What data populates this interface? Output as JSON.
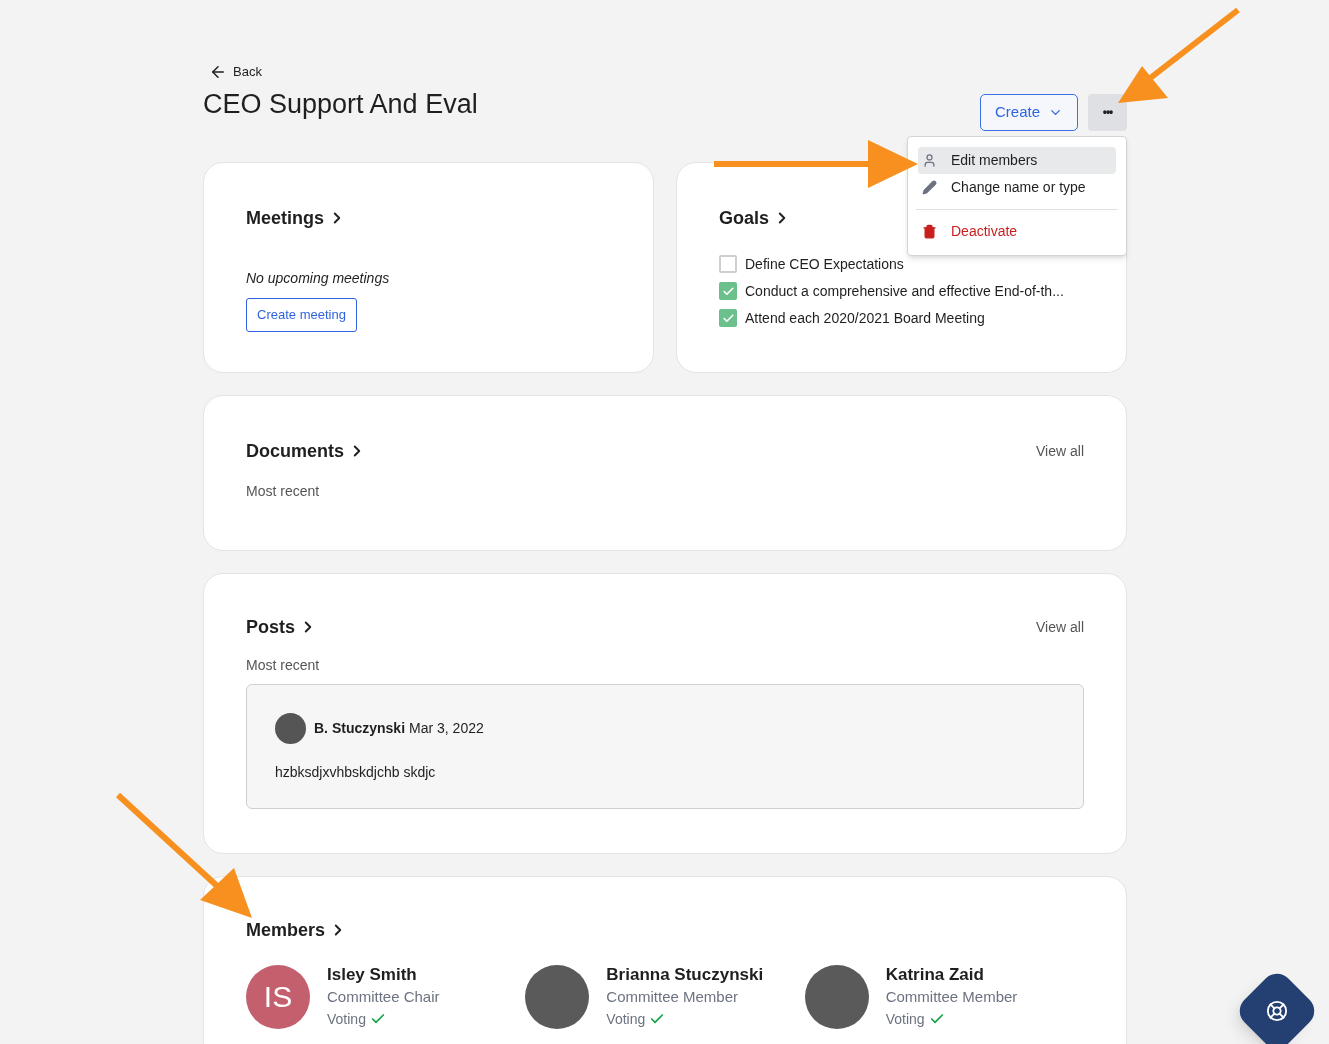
{
  "back": {
    "label": "Back"
  },
  "title": "CEO Support And Eval",
  "actions": {
    "create": "Create",
    "more": "•••"
  },
  "menu": [
    {
      "label": "Edit members",
      "kind": "person",
      "selected": true
    },
    {
      "label": "Change name or type",
      "kind": "pencil",
      "selected": false
    },
    {
      "label": "Deactivate",
      "kind": "danger",
      "selected": false
    }
  ],
  "meetings": {
    "title": "Meetings",
    "empty": "No upcoming meetings",
    "button": "Create meeting"
  },
  "goals": {
    "title": "Goals",
    "items": [
      {
        "label": "Define CEO Expectations",
        "checked": false
      },
      {
        "label": "Conduct a comprehensive and effective End-of-th...",
        "checked": true
      },
      {
        "label": "Attend each 2020/2021 Board Meeting",
        "checked": true
      }
    ]
  },
  "documents": {
    "title": "Documents",
    "view_all": "View all",
    "subtitle": "Most recent"
  },
  "posts": {
    "title": "Posts",
    "view_all": "View all",
    "subtitle": "Most recent",
    "items": [
      {
        "author": "B. Stuczynski",
        "date": "Mar 3, 2022",
        "body": "hzbksdjxvhbskdjchb skdjc"
      }
    ]
  },
  "members": {
    "title": "Members",
    "items": [
      {
        "name": "Isley Smith",
        "role": "Committee Chair",
        "status": "Voting",
        "initials": "IS",
        "color": "#c4606e"
      },
      {
        "name": "Brianna Stuczynski",
        "role": "Committee Member",
        "status": "Voting"
      },
      {
        "name": "Katrina Zaid",
        "role": "Committee Member",
        "status": "Voting"
      }
    ]
  }
}
